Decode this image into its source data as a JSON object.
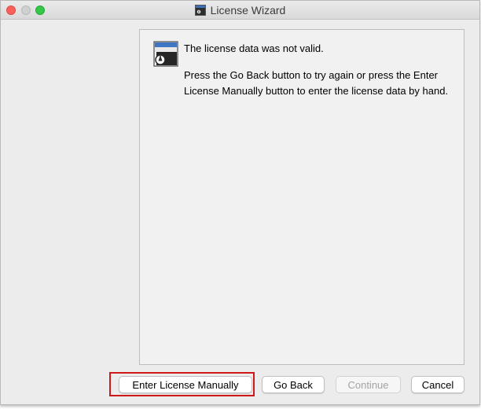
{
  "window": {
    "title": "License Wizard"
  },
  "message": {
    "icon": "license-window-icon",
    "title": "The license data was not valid.",
    "body": "Press the Go Back button to try again or press the Enter License Manually button to enter the license data by hand."
  },
  "buttons": {
    "enter_manually": "Enter License Manually",
    "go_back": "Go Back",
    "continue": "Continue",
    "cancel": "Cancel"
  },
  "colors": {
    "highlight": "#d01818",
    "close": "#fc605b",
    "maximize": "#34c748"
  }
}
